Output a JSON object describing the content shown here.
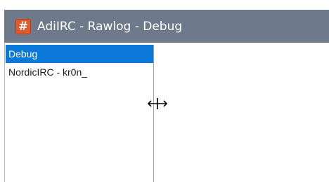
{
  "window": {
    "title": "AdiIRC - Rawlog - Debug",
    "app_icon_glyph": "#",
    "app_icon_color": "#e05a2a",
    "titlebar_color": "#6e7a8c"
  },
  "rawlog_list": {
    "items": [
      {
        "label": "Debug",
        "selected": true
      },
      {
        "label": "NordicIRC - kr0n_",
        "selected": false
      }
    ],
    "selection_color": "#0b78d7"
  },
  "cursor": {
    "type": "resize-horizontal-icon"
  }
}
